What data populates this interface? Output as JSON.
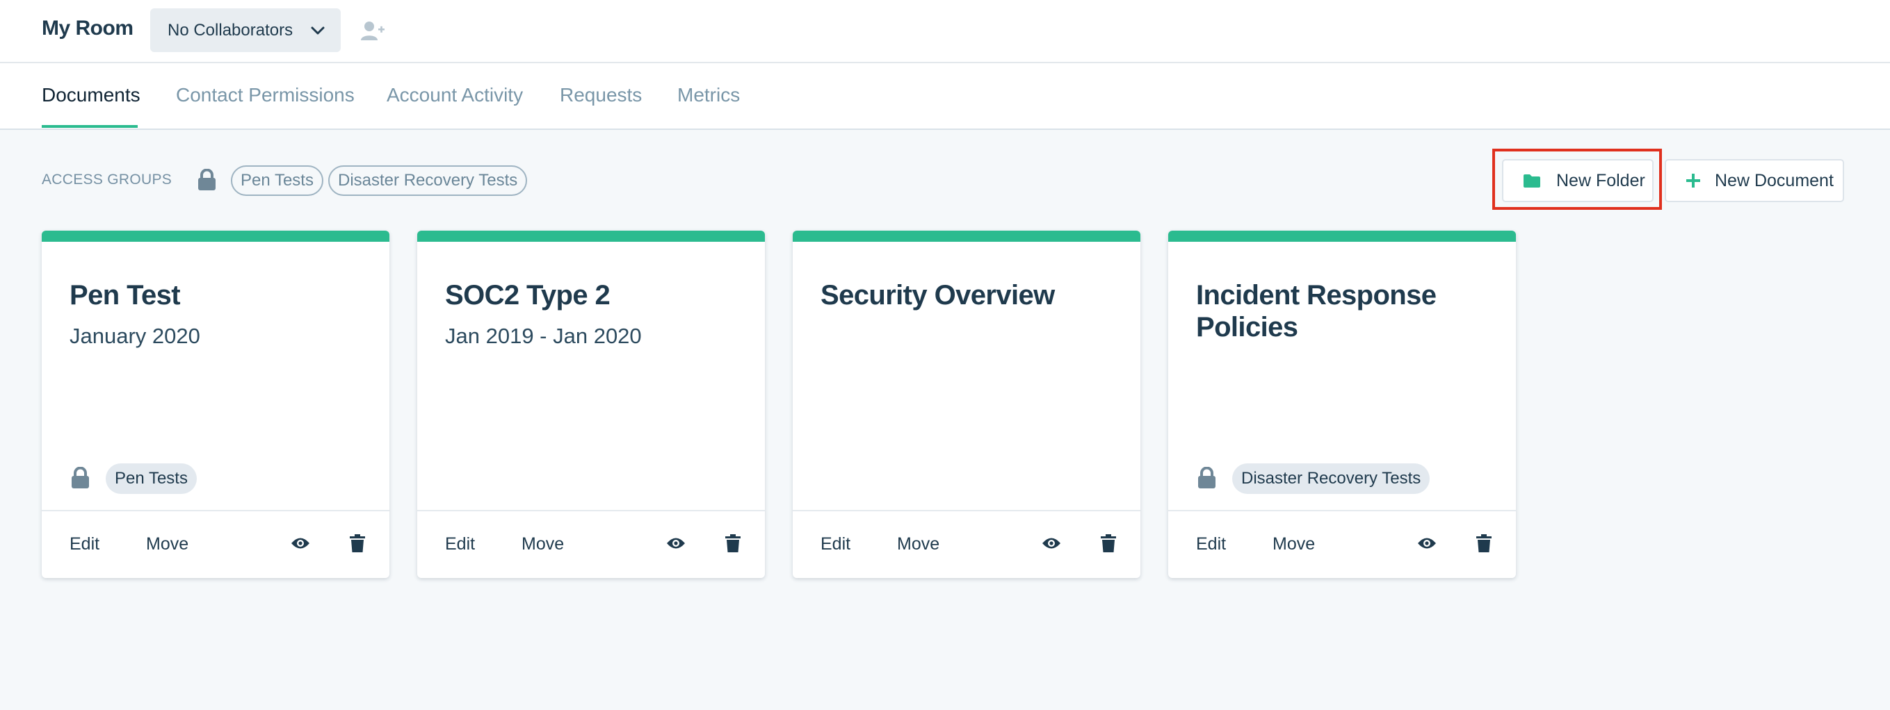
{
  "header": {
    "room_title": "My Room",
    "collaborators_label": "No Collaborators"
  },
  "tabs": [
    {
      "label": "Documents",
      "active": true
    },
    {
      "label": "Contact Permissions",
      "active": false
    },
    {
      "label": "Account Activity",
      "active": false
    },
    {
      "label": "Requests",
      "active": false
    },
    {
      "label": "Metrics",
      "active": false
    }
  ],
  "access_groups": {
    "label": "ACCESS GROUPS",
    "groups": [
      "Pen Tests",
      "Disaster Recovery Tests"
    ]
  },
  "actions": {
    "new_folder": "New Folder",
    "new_document": "New Document"
  },
  "cards": [
    {
      "title": "Pen Test",
      "subtitle": "January 2020",
      "access_group": "Pen Tests",
      "edit": "Edit",
      "move": "Move"
    },
    {
      "title": "SOC2 Type 2",
      "subtitle": "Jan 2019 - Jan 2020",
      "access_group": "",
      "edit": "Edit",
      "move": "Move"
    },
    {
      "title": "Security Overview",
      "subtitle": "",
      "access_group": "",
      "edit": "Edit",
      "move": "Move"
    },
    {
      "title": "Incident Response Policies",
      "subtitle": "",
      "access_group": "Disaster Recovery Tests",
      "edit": "Edit",
      "move": "Move"
    }
  ],
  "colors": {
    "accent": "#2bbb8f",
    "text_dark": "#1f3a4d",
    "text_muted": "#7996a8",
    "highlight": "#e0301e"
  }
}
